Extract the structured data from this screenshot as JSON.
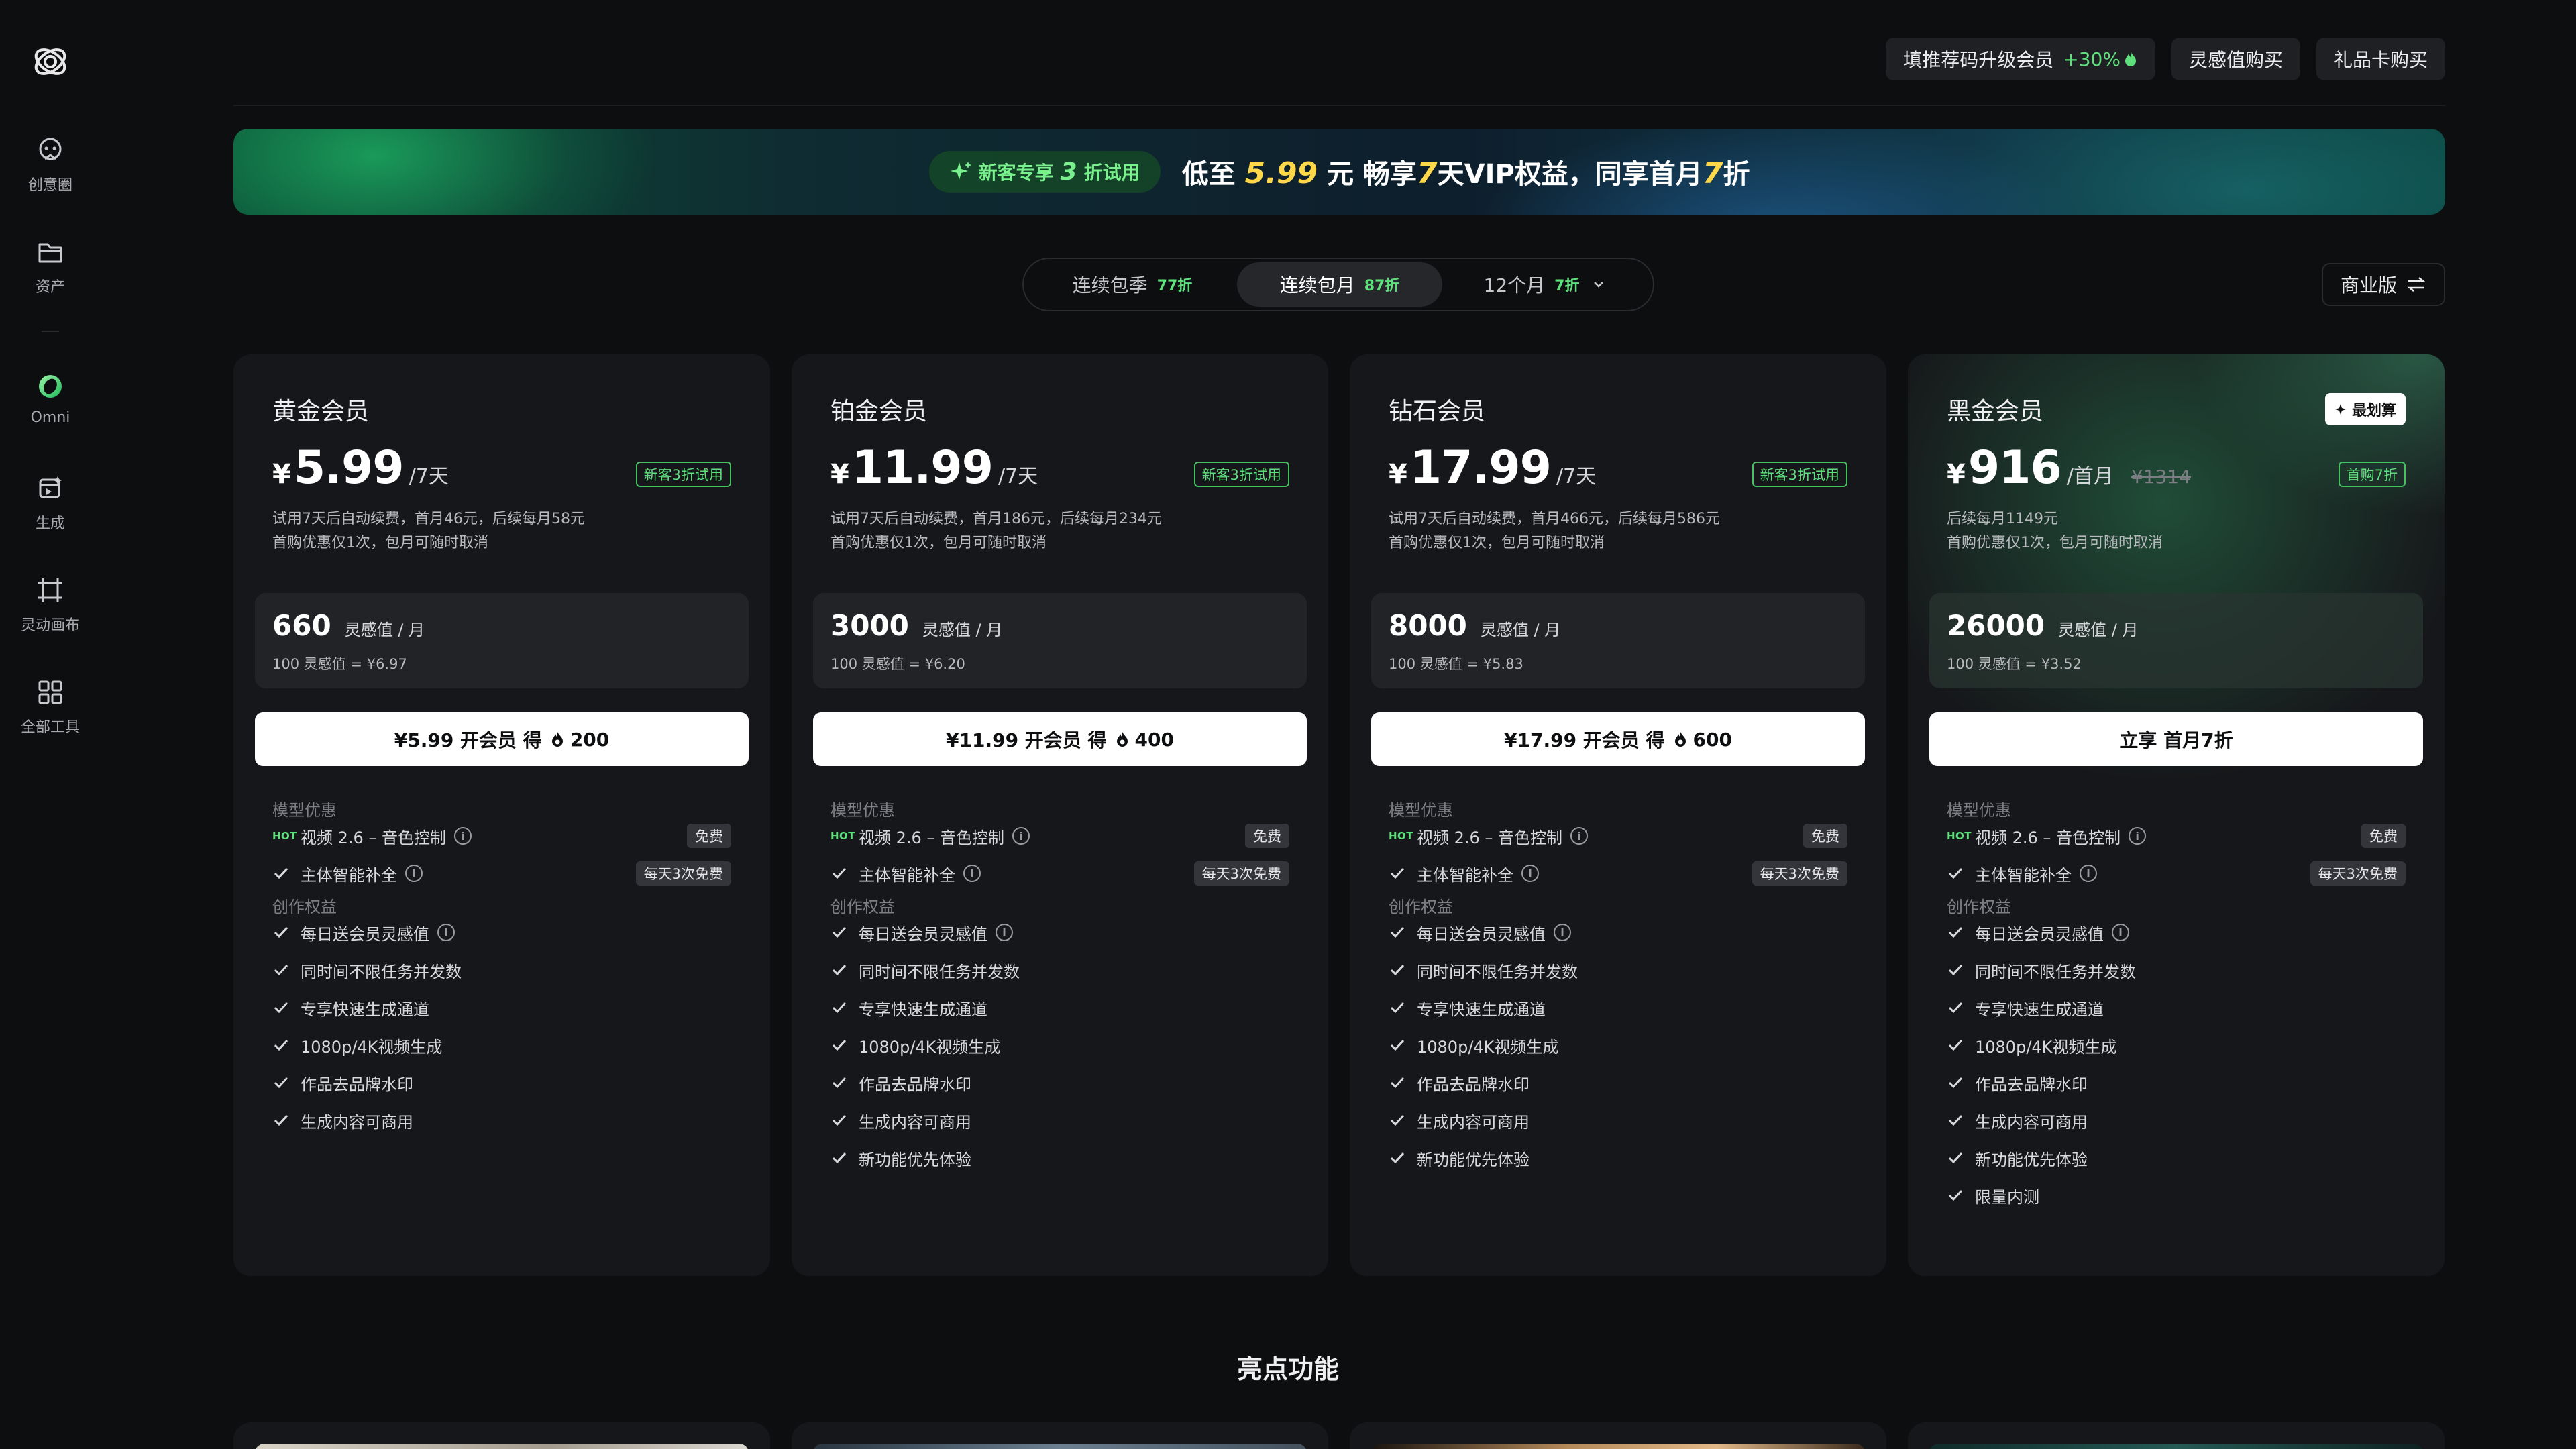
{
  "sidebar": {
    "items": [
      {
        "label": "创意圈",
        "icon": "community-icon"
      },
      {
        "label": "资产",
        "icon": "folder-icon"
      },
      {
        "label": "Omni",
        "icon": "omni-icon"
      },
      {
        "label": "生成",
        "icon": "generate-icon"
      },
      {
        "label": "灵动画布",
        "icon": "canvas-icon"
      },
      {
        "label": "全部工具",
        "icon": "grid-icon"
      }
    ]
  },
  "topbar": {
    "referral": {
      "label": "填推荐码升级会员",
      "bonus": "+30%"
    },
    "buy_credits": "灵感值购买",
    "buy_giftcard": "礼品卡购买"
  },
  "banner": {
    "tag_prefix": "新客专享",
    "tag_num": "3",
    "tag_suffix": "折试用",
    "t1": "低至",
    "t_price": "5.99",
    "t2": "元  畅享",
    "t_days": "7",
    "t3": "天VIP权益，同享首月",
    "t_disc": "7",
    "t4": "折"
  },
  "period_tabs": [
    {
      "label": "连续包季",
      "discount": "77折",
      "active": false
    },
    {
      "label": "连续包月",
      "discount": "87折",
      "active": true
    },
    {
      "label": "12个月",
      "discount": "7折",
      "active": false
    }
  ],
  "business_toggle": "商业版",
  "sections": {
    "model": "模型优惠",
    "create": "创作权益",
    "highlights": "亮点功能"
  },
  "plans": [
    {
      "name": "黄金会员",
      "currency": "¥",
      "price": "5.99",
      "unit": "/7天",
      "original": "",
      "badge": "新客3折试用",
      "best": "",
      "desc1": "试用7天后自动续费，首月46元，后续每月58元",
      "desc2": "首购优惠仅1次，包月可随时取消",
      "credits": "660",
      "credit_unit": "灵感值 / 月",
      "credit_rate": "100 灵感值 = ¥6.97",
      "button": "¥5.99 开会员  得",
      "button_bonus": "200",
      "model_feats": [
        {
          "hot": true,
          "label": "视频 2.6 – 音色控制",
          "info": true,
          "tag": "免费"
        },
        {
          "hot": false,
          "label": "主体智能补全",
          "info": true,
          "tag": "每天3次免费"
        }
      ],
      "create_feats": [
        {
          "label": "每日送会员灵感值",
          "info": true
        },
        {
          "label": "同时间不限任务并发数",
          "info": false
        },
        {
          "label": "专享快速生成通道",
          "info": false
        },
        {
          "label": "1080p/4K视频生成",
          "info": false
        },
        {
          "label": "作品去品牌水印",
          "info": false
        },
        {
          "label": "生成内容可商用",
          "info": false
        }
      ]
    },
    {
      "name": "铂金会员",
      "currency": "¥",
      "price": "11.99",
      "unit": "/7天",
      "original": "",
      "badge": "新客3折试用",
      "best": "",
      "desc1": "试用7天后自动续费，首月186元，后续每月234元",
      "desc2": "首购优惠仅1次，包月可随时取消",
      "credits": "3000",
      "credit_unit": "灵感值 / 月",
      "credit_rate": "100 灵感值 = ¥6.20",
      "button": "¥11.99 开会员  得",
      "button_bonus": "400",
      "model_feats": [
        {
          "hot": true,
          "label": "视频 2.6 – 音色控制",
          "info": true,
          "tag": "免费"
        },
        {
          "hot": false,
          "label": "主体智能补全",
          "info": true,
          "tag": "每天3次免费"
        }
      ],
      "create_feats": [
        {
          "label": "每日送会员灵感值",
          "info": true
        },
        {
          "label": "同时间不限任务并发数",
          "info": false
        },
        {
          "label": "专享快速生成通道",
          "info": false
        },
        {
          "label": "1080p/4K视频生成",
          "info": false
        },
        {
          "label": "作品去品牌水印",
          "info": false
        },
        {
          "label": "生成内容可商用",
          "info": false
        },
        {
          "label": "新功能优先体验",
          "info": false
        }
      ]
    },
    {
      "name": "钻石会员",
      "currency": "¥",
      "price": "17.99",
      "unit": "/7天",
      "original": "",
      "badge": "新客3折试用",
      "best": "",
      "desc1": "试用7天后自动续费，首月466元，后续每月586元",
      "desc2": "首购优惠仅1次，包月可随时取消",
      "credits": "8000",
      "credit_unit": "灵感值 / 月",
      "credit_rate": "100 灵感值 = ¥5.83",
      "button": "¥17.99 开会员  得",
      "button_bonus": "600",
      "model_feats": [
        {
          "hot": true,
          "label": "视频 2.6 – 音色控制",
          "info": true,
          "tag": "免费"
        },
        {
          "hot": false,
          "label": "主体智能补全",
          "info": true,
          "tag": "每天3次免费"
        }
      ],
      "create_feats": [
        {
          "label": "每日送会员灵感值",
          "info": true
        },
        {
          "label": "同时间不限任务并发数",
          "info": false
        },
        {
          "label": "专享快速生成通道",
          "info": false
        },
        {
          "label": "1080p/4K视频生成",
          "info": false
        },
        {
          "label": "作品去品牌水印",
          "info": false
        },
        {
          "label": "生成内容可商用",
          "info": false
        },
        {
          "label": "新功能优先体验",
          "info": false
        }
      ]
    },
    {
      "name": "黑金会员",
      "currency": "¥",
      "price": "916",
      "unit": "/首月",
      "original": "¥1314",
      "badge": "首购7折",
      "best": "最划算",
      "desc1": "后续每月1149元",
      "desc2": "首购优惠仅1次，包月可随时取消",
      "credits": "26000",
      "credit_unit": "灵感值 / 月",
      "credit_rate": "100 灵感值 = ¥3.52",
      "button": "立享 首月7折",
      "button_bonus": "",
      "model_feats": [
        {
          "hot": true,
          "label": "视频 2.6 – 音色控制",
          "info": true,
          "tag": "免费"
        },
        {
          "hot": false,
          "label": "主体智能补全",
          "info": true,
          "tag": "每天3次免费"
        }
      ],
      "create_feats": [
        {
          "label": "每日送会员灵感值",
          "info": true
        },
        {
          "label": "同时间不限任务并发数",
          "info": false
        },
        {
          "label": "专享快速生成通道",
          "info": false
        },
        {
          "label": "1080p/4K视频生成",
          "info": false
        },
        {
          "label": "作品去品牌水印",
          "info": false
        },
        {
          "label": "生成内容可商用",
          "info": false
        },
        {
          "label": "新功能优先体验",
          "info": false
        },
        {
          "label": "限量内测",
          "info": false
        }
      ]
    }
  ],
  "hot_label": "HOT",
  "colors": {
    "accent_green": "#5fe07c",
    "highlight_yellow": "#ffd84a",
    "card_bg": "#16171a"
  }
}
